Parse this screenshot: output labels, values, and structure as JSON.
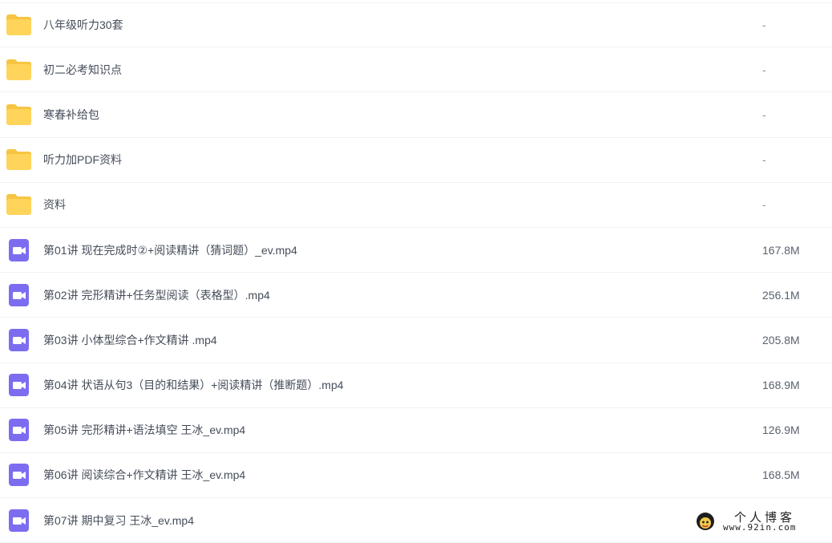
{
  "files": [
    {
      "type": "folder",
      "icon": "folder-icon",
      "name": "八年级听力30套",
      "size": "-"
    },
    {
      "type": "folder",
      "icon": "folder-icon",
      "name": "初二必考知识点",
      "size": "-"
    },
    {
      "type": "folder",
      "icon": "folder-icon",
      "name": "寒春补给包",
      "size": "-"
    },
    {
      "type": "folder",
      "icon": "folder-icon",
      "name": "听力加PDF资料",
      "size": "-"
    },
    {
      "type": "folder",
      "icon": "folder-icon",
      "name": "资料",
      "size": "-"
    },
    {
      "type": "video",
      "icon": "video-file-icon",
      "name": "第01讲 现在完成时②+阅读精讲（猜词题）_ev.mp4",
      "size": "167.8M"
    },
    {
      "type": "video",
      "icon": "video-file-icon",
      "name": "第02讲 完形精讲+任务型阅读（表格型）.mp4",
      "size": "256.1M"
    },
    {
      "type": "video",
      "icon": "video-file-icon",
      "name": "第03讲 小体型综合+作文精讲 .mp4",
      "size": "205.8M"
    },
    {
      "type": "video",
      "icon": "video-file-icon",
      "name": "第04讲 状语从句3（目的和结果）+阅读精讲（推断题）.mp4",
      "size": "168.9M"
    },
    {
      "type": "video",
      "icon": "video-file-icon",
      "name": "第05讲 完形精讲+语法填空 王冰_ev.mp4",
      "size": "126.9M"
    },
    {
      "type": "video",
      "icon": "video-file-icon",
      "name": "第06讲 阅读综合+作文精讲 王冰_ev.mp4",
      "size": "168.5M"
    },
    {
      "type": "video",
      "icon": "video-file-icon",
      "name": "第07讲 期中复习 王冰_ev.mp4",
      "size": ""
    }
  ],
  "colors": {
    "folder": "#ffd45a",
    "folder_back": "#f7c543",
    "video": "#7c6df0"
  },
  "watermark": {
    "title": "个人博客",
    "url": "www.92in.com"
  }
}
